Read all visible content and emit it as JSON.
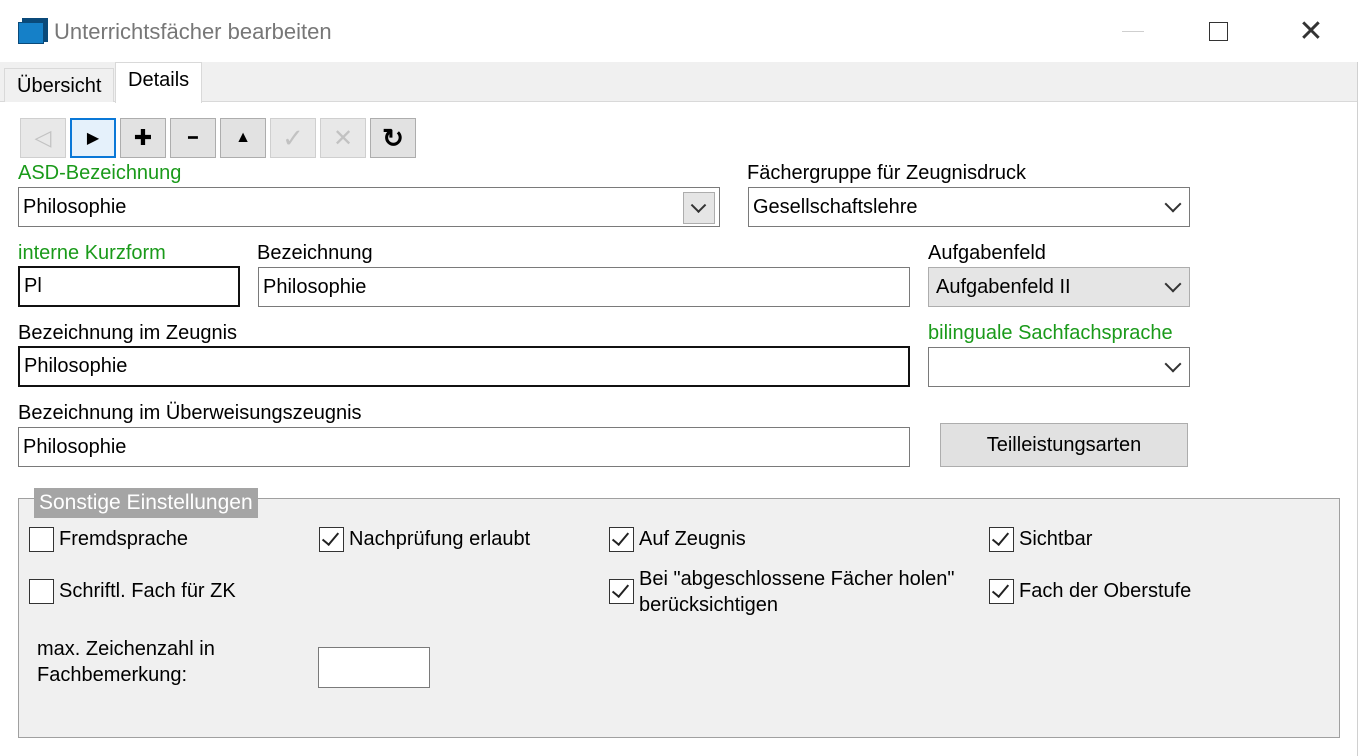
{
  "window": {
    "title": "Unterrichtsfächer bearbeiten"
  },
  "tabs": [
    {
      "label": "Übersicht",
      "selected": false
    },
    {
      "label": "Details",
      "selected": true
    }
  ],
  "toolbar": {
    "buttons": [
      {
        "name": "first",
        "glyph": "◁",
        "enabled": false
      },
      {
        "name": "next",
        "glyph": "▶",
        "enabled": true
      },
      {
        "name": "add",
        "glyph": "✚",
        "enabled": true
      },
      {
        "name": "delete",
        "glyph": "━",
        "enabled": true
      },
      {
        "name": "up",
        "glyph": "▲",
        "enabled": true
      },
      {
        "name": "save",
        "glyph": "✓",
        "enabled": false
      },
      {
        "name": "cancel",
        "glyph": "✕",
        "enabled": false
      },
      {
        "name": "refresh",
        "glyph": "↻",
        "enabled": true
      }
    ]
  },
  "form": {
    "asd": {
      "label": "ASD-Bezeichnung",
      "value": "Philosophie"
    },
    "faechergruppe": {
      "label": "Fächergruppe für Zeugnisdruck",
      "value": "Gesellschaftslehre"
    },
    "kurzform": {
      "label": "interne Kurzform",
      "value": "Pl"
    },
    "bezeichnung": {
      "label": "Bezeichnung",
      "value": "Philosophie"
    },
    "aufgabenfeld": {
      "label": "Aufgabenfeld",
      "value": "Aufgabenfeld II"
    },
    "zeugnis": {
      "label": "Bezeichnung im Zeugnis",
      "value": "Philosophie"
    },
    "bilingual": {
      "label": "bilinguale Sachfachsprache",
      "value": ""
    },
    "ueberweisung": {
      "label": "Bezeichnung im Überweisungszeugnis",
      "value": "Philosophie"
    },
    "teilleistungen_button": "Teilleistungsarten"
  },
  "group": {
    "title": "Sonstige Einstellungen",
    "checkboxes": {
      "fremdsprache": {
        "label": "Fremdsprache",
        "checked": false
      },
      "nachpruefung": {
        "label": "Nachprüfung erlaubt",
        "checked": true
      },
      "auf_zeugnis": {
        "label": "Auf Zeugnis",
        "checked": true
      },
      "sichtbar": {
        "label": "Sichtbar",
        "checked": true
      },
      "schriftl": {
        "label": "Schriftl. Fach für ZK",
        "checked": false
      },
      "abgeschlossen": {
        "label_line1": "Bei \"abgeschlossene Fächer holen\"",
        "label_line2": "berücksichtigen",
        "checked": true
      },
      "oberstufe": {
        "label": "Fach der Oberstufe",
        "checked": true
      }
    },
    "max_zeichen": {
      "label_line1": "max. Zeichenzahl in",
      "label_line2": "Fachbemerkung:",
      "value": ""
    }
  }
}
